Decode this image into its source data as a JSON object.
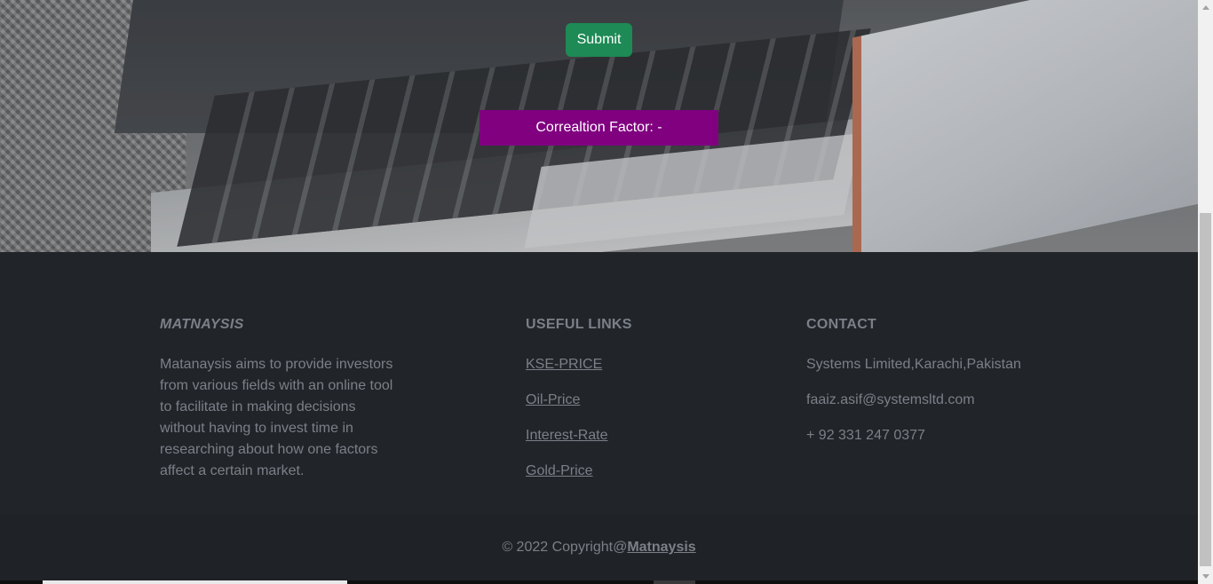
{
  "hero": {
    "submit_label": "Submit",
    "correlation_label": "Correaltion Factor: -"
  },
  "footer": {
    "brand": {
      "title": "MATNAYSIS",
      "description": "Matanaysis aims to provide investors from various fields with an online tool to facilitate in making decisions without having to invest time in researching about how one factors affect a certain market."
    },
    "links": {
      "title": "USEFUL LINKS",
      "items": [
        "KSE-PRICE",
        "Oil-Price",
        "Interest-Rate",
        "Gold-Price"
      ]
    },
    "contact": {
      "title": "CONTACT",
      "address": "Systems Limited,Karachi,Pakistan",
      "email": "faaiz.asif@systemsltd.com",
      "phone": "+ 92 331 247 0377"
    },
    "copyright": {
      "text": "© 2022 Copyright@",
      "link": "Matnaysis"
    }
  },
  "colors": {
    "submit_bg": "#1e8a55",
    "correlation_bg": "#800080",
    "footer_bg": "#212429",
    "footer_text": "#7b8088"
  }
}
